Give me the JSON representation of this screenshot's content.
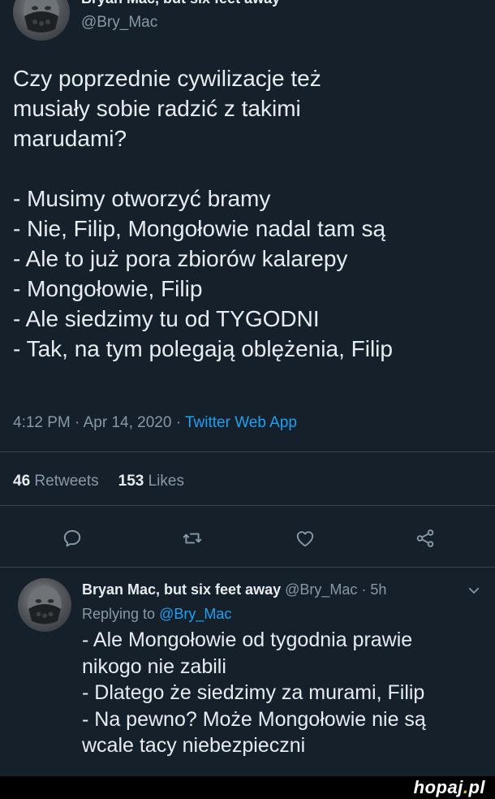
{
  "tweet": {
    "author_name": "Bryan Mac, but six feet away",
    "author_handle": "@Bry_Mac",
    "text": "Czy poprzednie cywilizacje też\nmusiały sobie radzić z takimi\nmarudami?\n\n- Musimy otworzyć bramy\n- Nie, Filip, Mongołowie nadal tam są\n- Ale to już pora zbiorów kalarepy\n- Mongołowie, Filip\n- Ale siedzimy tu od TYGODNI\n- Tak, na tym polegają oblężenia, Filip",
    "time": "4:12 PM",
    "date": "Apr 14, 2020",
    "separator": " · ",
    "app": "Twitter Web App",
    "retweets_count": "46",
    "retweets_label": "Retweets",
    "likes_count": "153",
    "likes_label": "Likes",
    "actions": [
      {
        "icon": "reply-icon"
      },
      {
        "icon": "retweet-icon"
      },
      {
        "icon": "like-icon"
      },
      {
        "icon": "share-icon"
      }
    ]
  },
  "reply": {
    "author_name": "Bryan Mac, but six feet away",
    "author_handle": "@Bry_Mac",
    "age": "5h",
    "replying_prefix": "Replying to ",
    "replying_to": "@Bry_Mac",
    "text": "- Ale Mongołowie od tygodnia prawie\nnikogo nie zabili\n- Dlatego że siedzimy za murami, Filip\n- Na pewno? Może Mongołowie nie są\nwcale tacy niebezpieczni",
    "menu_icon": "chevron-down-icon"
  },
  "watermark": {
    "text_main": "hopaj",
    "text_dot": ".",
    "text_tld": "pl"
  },
  "colors": {
    "background": "#15202b",
    "text": "#e6ecf0",
    "secondary": "#8899a6",
    "accent": "#1da1f2",
    "divider": "#38444d"
  }
}
